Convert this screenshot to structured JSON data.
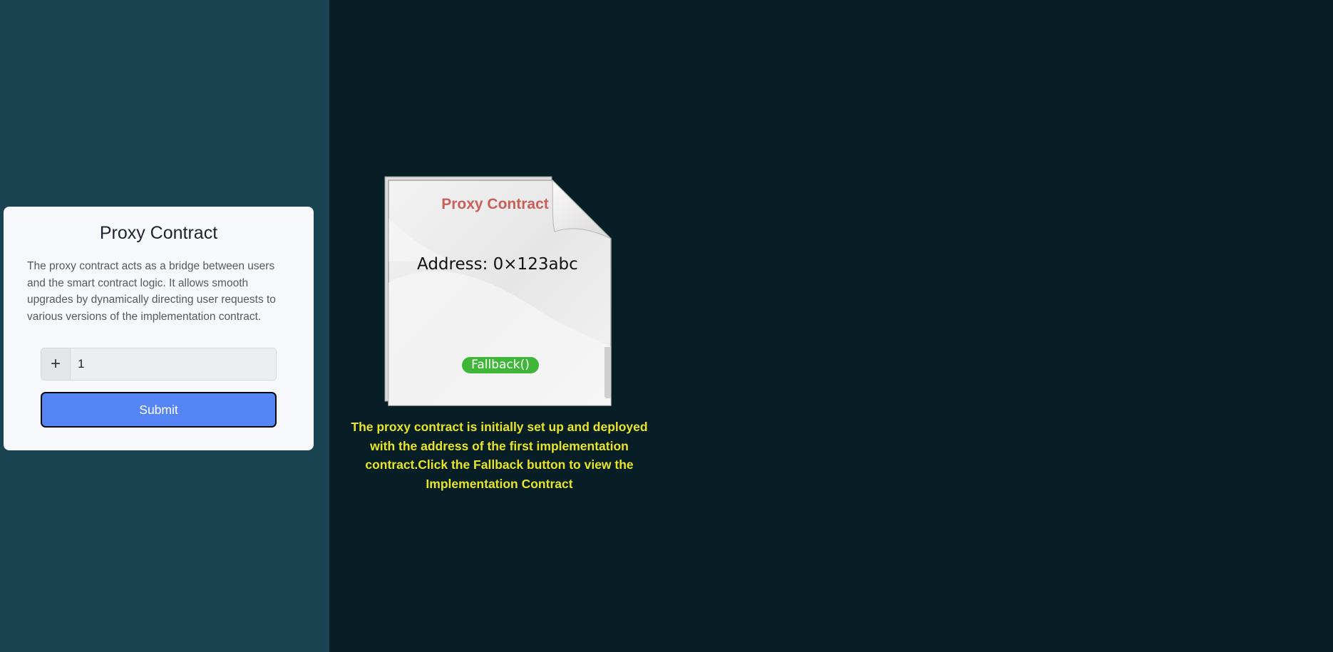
{
  "card": {
    "title": "Proxy Contract",
    "description": "The proxy contract acts as a bridge between users and the smart contract logic. It allows smooth upgrades by dynamically directing user requests to various versions of the implementation contract.",
    "input_prefix": "+",
    "input_value": "1",
    "submit_label": "Submit"
  },
  "contract_doc": {
    "title": "Proxy Contract",
    "address": "Address: 0×123abc",
    "fallback_label": "Fallback()"
  },
  "caption": "The proxy contract is initially set up and deployed with the address of the first implementation contract.Click the Fallback button to view the Implementation Contract",
  "colors": {
    "left_panel_bg": "#1a4452",
    "page_bg": "#071e26",
    "submit_button": "#5585f5",
    "fallback_button": "#3fb638",
    "doc_title": "#c8605a",
    "caption_text": "#e8e42a"
  }
}
